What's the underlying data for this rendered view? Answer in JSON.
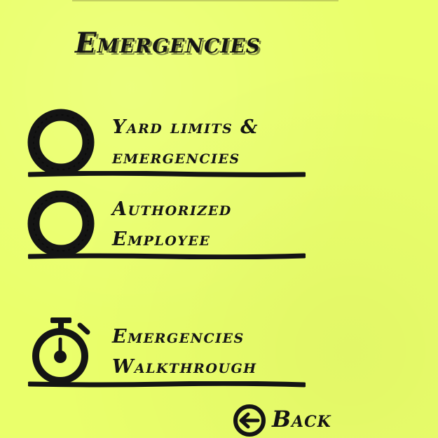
{
  "screen": {
    "title": "Emergencies"
  },
  "menu": {
    "items": [
      {
        "id": "yard-limits",
        "line1": "Yard limits &",
        "line2": "emergencies",
        "icon": "circle-outline-icon"
      },
      {
        "id": "authorized-employee",
        "line1": "Authorized",
        "line2": "Employee",
        "icon": "circle-outline-icon"
      },
      {
        "id": "walkthrough",
        "line1": "Emergencies",
        "line2": "Walkthrough",
        "icon": "stopwatch-icon"
      }
    ]
  },
  "navigation": {
    "back_label": "Back",
    "back_icon": "arrow-left-circle-icon"
  },
  "colors": {
    "background": "#eaff6b",
    "ink": "#141414"
  }
}
